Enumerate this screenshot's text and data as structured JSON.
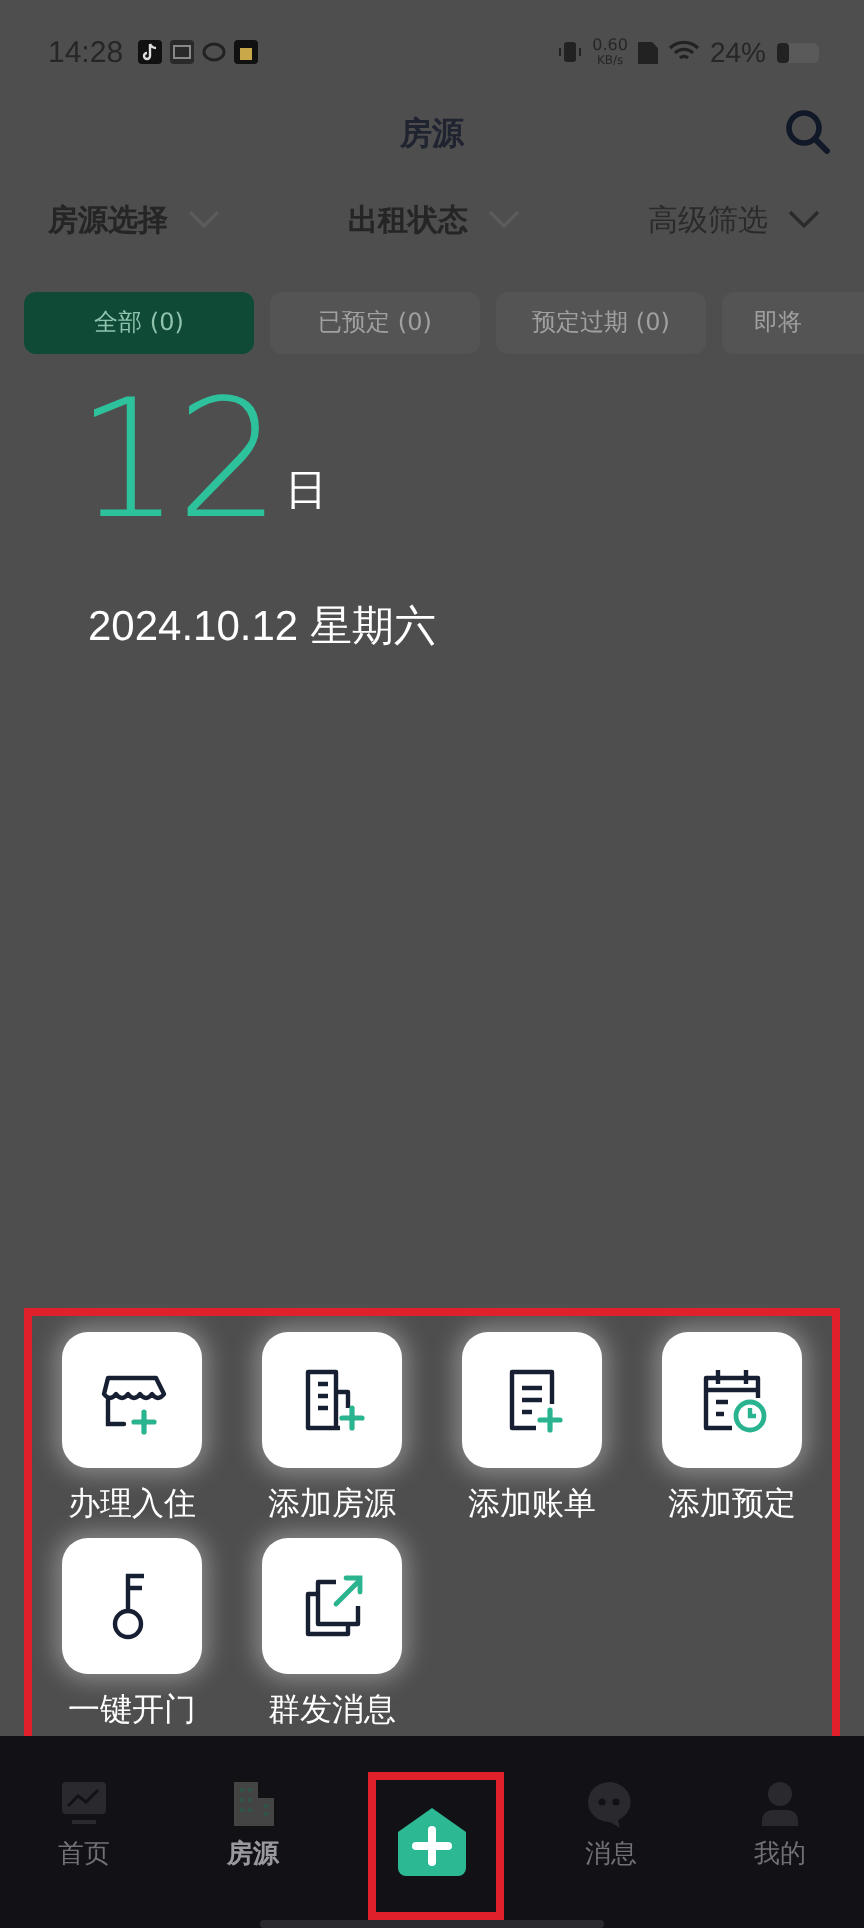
{
  "status_bar": {
    "time": "14:28",
    "net_speed": "0.60",
    "net_unit": "KB/s",
    "battery": "24%"
  },
  "header": {
    "title": "房源"
  },
  "filters": [
    {
      "label": "房源选择"
    },
    {
      "label": "出租状态"
    },
    {
      "label": "高级筛选"
    }
  ],
  "chips": [
    {
      "label": "全部 (0)",
      "selected": true
    },
    {
      "label": "已预定 (0)",
      "selected": false
    },
    {
      "label": "预定过期 (0)",
      "selected": false
    },
    {
      "label": "即将",
      "selected": false
    }
  ],
  "date_overlay": {
    "day": "12",
    "day_unit": "日",
    "date": "2024.10.12 星期六"
  },
  "actions": [
    {
      "label": "办理入住",
      "kind": "checkin"
    },
    {
      "label": "添加房源",
      "kind": "building"
    },
    {
      "label": "添加账单",
      "kind": "bill"
    },
    {
      "label": "添加预定",
      "kind": "booking"
    },
    {
      "label": "一键开门",
      "kind": "key"
    },
    {
      "label": "群发消息",
      "kind": "broadcast"
    }
  ],
  "nav": [
    {
      "label": "首页",
      "kind": "chart",
      "selected": false
    },
    {
      "label": "房源",
      "kind": "building",
      "selected": true
    },
    {
      "kind": "add"
    },
    {
      "label": "消息",
      "kind": "chat",
      "selected": false
    },
    {
      "label": "我的",
      "kind": "user",
      "selected": false
    }
  ]
}
